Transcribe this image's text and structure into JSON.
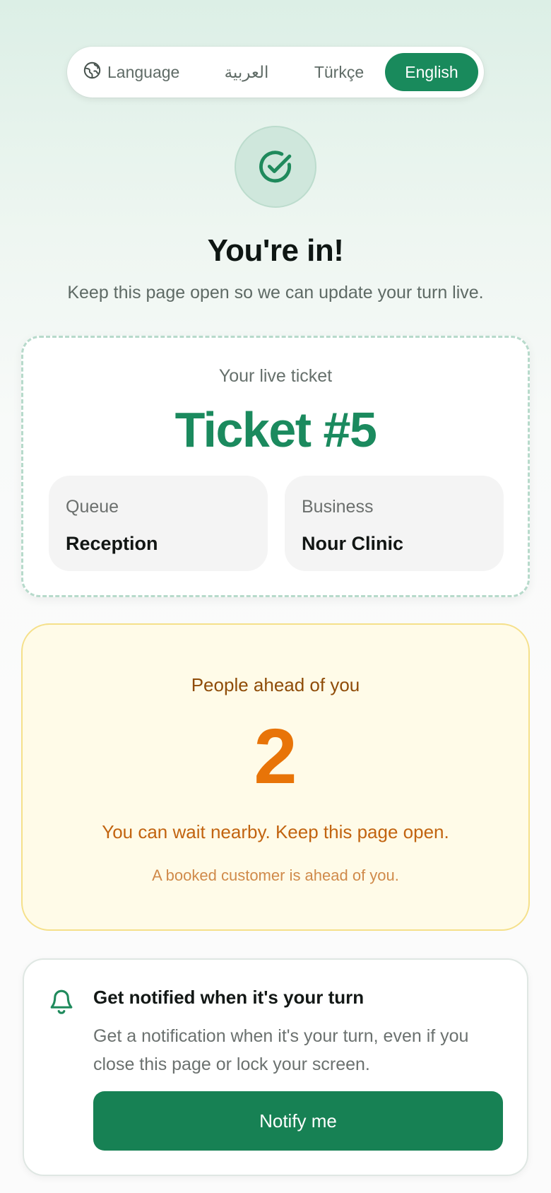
{
  "language_switcher": {
    "label": "Language",
    "options": [
      "العربية",
      "Türkçe",
      "English"
    ],
    "selected": "English"
  },
  "header": {
    "title": "You're in!",
    "subtitle": "Keep this page open so we can update your turn live."
  },
  "ticket": {
    "label": "Your live ticket",
    "number_text": "Ticket #5",
    "queue_label": "Queue",
    "queue_value": "Reception",
    "business_label": "Business",
    "business_value": "Nour Clinic"
  },
  "ahead": {
    "title": "People ahead of you",
    "count": "2",
    "message": "You can wait nearby. Keep this page open.",
    "note": "A booked customer is ahead of you."
  },
  "notify": {
    "title": "Get notified when it's your turn",
    "description": "Get a notification when it's your turn, even if you close this page or lock your screen.",
    "button_label": "Notify me"
  },
  "colors": {
    "brand_green": "#198a5c",
    "ticket_green": "#1b8a5e",
    "ahead_orange": "#e87408",
    "ahead_bg": "#fffbe8"
  },
  "icons": {
    "language": "globe-icon",
    "success": "check-circle-icon",
    "notify": "bell-icon"
  }
}
